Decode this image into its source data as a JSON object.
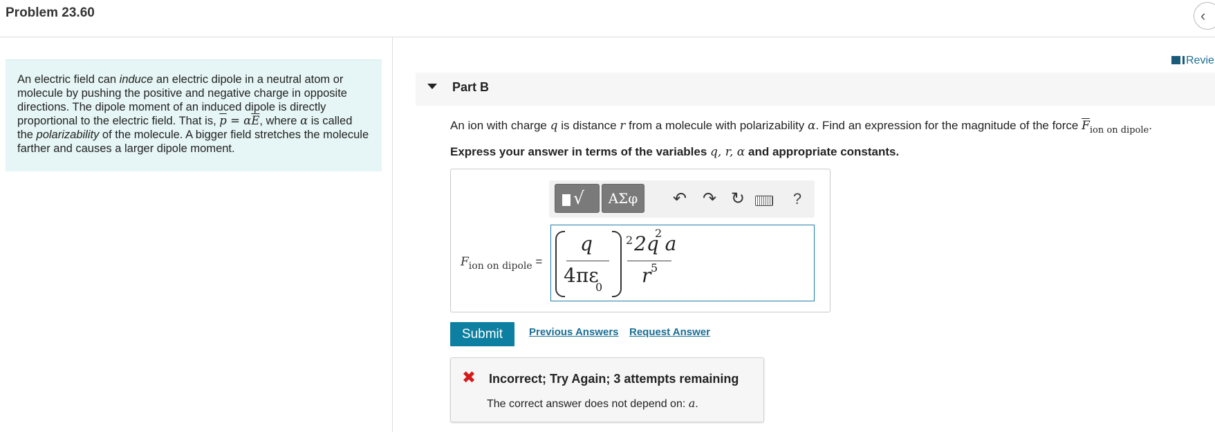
{
  "header": {
    "title": "Problem 23.60",
    "back_glyph": "‹"
  },
  "intro": {
    "s1a": "An electric field can ",
    "s1em": "induce",
    "s1b": " an electric dipole in a neutral atom or molecule by pushing the positive and negative charge in opposite directions. The dipole moment of an induced dipole is directly proportional to the electric field. That is, ",
    "math_p": "p",
    "math_eq": " = ",
    "math_alpha": "α",
    "math_E": "E",
    "s2": ", where ",
    "s2alpha": "α",
    "s3a": " is called the ",
    "s3em": "polarizability",
    "s3b": " of the molecule. A bigger field stretches the molecule farther and causes a larger dipole moment."
  },
  "review": {
    "label": "Revie"
  },
  "part": {
    "label": "Part B"
  },
  "question": {
    "a": "An ion with charge ",
    "q": "q",
    "b": " is distance ",
    "r": "r",
    "c": " from a molecule with polarizability ",
    "alpha": "α",
    "d": ". Find an expression for the magnitude of the force ",
    "F": "F",
    "sub": "ion on dipole",
    "end": "."
  },
  "instructions": {
    "a": "Express your answer in terms of the variables ",
    "vars": "q, r, α",
    "b": " and appropriate constants."
  },
  "toolbar": {
    "templates_glyph": "√",
    "greek_label": "ΑΣφ",
    "undo_glyph": "↶",
    "redo_glyph": "↷",
    "reset_glyph": "↻",
    "help_label": "?"
  },
  "answer": {
    "lhs_F": "F",
    "lhs_sub": "ion on dipole",
    "lhs_eq": " = ",
    "frac1_num": "q",
    "frac1_den": "4πε",
    "frac1_den_sub": "0",
    "exp": "2",
    "frac2_num": "2q a",
    "frac2_num_sup": "2",
    "frac2_den": "r",
    "frac2_den_sup": "5"
  },
  "actions": {
    "submit_label": "Submit",
    "previous_answers": "Previous Answers",
    "request_answer": "Request Answer"
  },
  "feedback": {
    "icon": "✖",
    "title": "Incorrect; Try Again; 3 attempts remaining",
    "text_a": "The correct answer does not depend on: ",
    "text_var": "a",
    "text_end": "."
  }
}
